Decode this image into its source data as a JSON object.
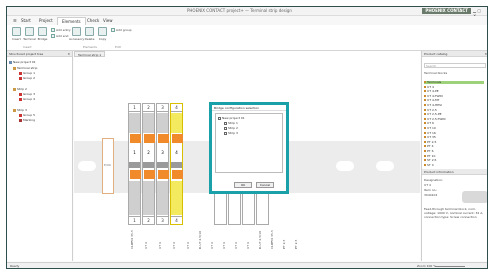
{
  "window": {
    "title": "PHOENIX CONTACT project+ — Terminal strip design",
    "logo": "PHOENIX CONTACT"
  },
  "menu": {
    "tabs": [
      "Start",
      "Project",
      "Elements",
      "Check",
      "View"
    ]
  },
  "ribbon": {
    "buttons": [
      "Insert",
      "Terminal",
      "Bridge",
      "Accessory",
      "Delete",
      "Copy"
    ],
    "small": [
      "Add entry",
      "Add end",
      "Add group"
    ],
    "groups": [
      "Insert",
      "Elements",
      "Edit"
    ]
  },
  "left_panel": {
    "header": "Structured project tree",
    "items": [
      "New project 01",
      "Terminal strip",
      "Group 1",
      "Group 2",
      "Strip 2",
      "Group 3",
      "Group 4",
      "Strip 3",
      "Group 5",
      "Marking"
    ]
  },
  "canvas": {
    "tab": "Terminal strip 1",
    "end_label": "E/UK",
    "terminal_numbers_top": [
      "1",
      "2",
      "3",
      "4"
    ],
    "terminal_numbers_mid": [
      "1",
      "2",
      "3",
      "4"
    ],
    "terminal_numbers_bottom": [
      "1",
      "2",
      "3",
      "4"
    ],
    "right_numbers": [
      "3",
      "4",
      "1",
      "2"
    ],
    "bottom_labels": [
      "CLIPFIX 35-5",
      "UT 4",
      "UT 4",
      "UT 4",
      "UT 4",
      "D-UT 2,5/10",
      "UT 4",
      "UT 4",
      "UT 4",
      "UT 4",
      "D-UT 2,5/10",
      "CLIPFIX 35-5",
      "PT 2,5",
      "PT 2,5"
    ]
  },
  "dialog": {
    "title": "Bridge configuration selection",
    "tree": [
      "New project 01",
      "Strip 1",
      "Strip 2",
      "Strip 3"
    ],
    "ok": "OK",
    "cancel": "Cancel"
  },
  "right_panel": {
    "header": "Product catalog",
    "search_placeholder": "Search",
    "filter": "Terminal blocks",
    "items": [
      "Terminals",
      "UT 4",
      "UT 4-PE",
      "UT 4-TWIN",
      "UT 4-MT",
      "UT 4-HESI",
      "UT 2,5",
      "UT 2,5-PE",
      "UT 2,5-TWIN",
      "UT 6",
      "UT 10",
      "UT 16",
      "UT 35",
      "PT 2,5",
      "PT 4",
      "PT 6",
      "PT 10",
      "ST 2,5",
      "ST 4"
    ],
    "selected_index": 0,
    "props_header": "Product information",
    "props": [
      "Designation:",
      "UT 4",
      "Item no.:",
      "3044102"
    ],
    "desc": "Feed-through terminal block, nom. voltage: 1000 V, nominal current: 32 A, connection type: Screw connection"
  },
  "status": {
    "left": "Ready",
    "zoom_label": "Zoom 100 %"
  }
}
